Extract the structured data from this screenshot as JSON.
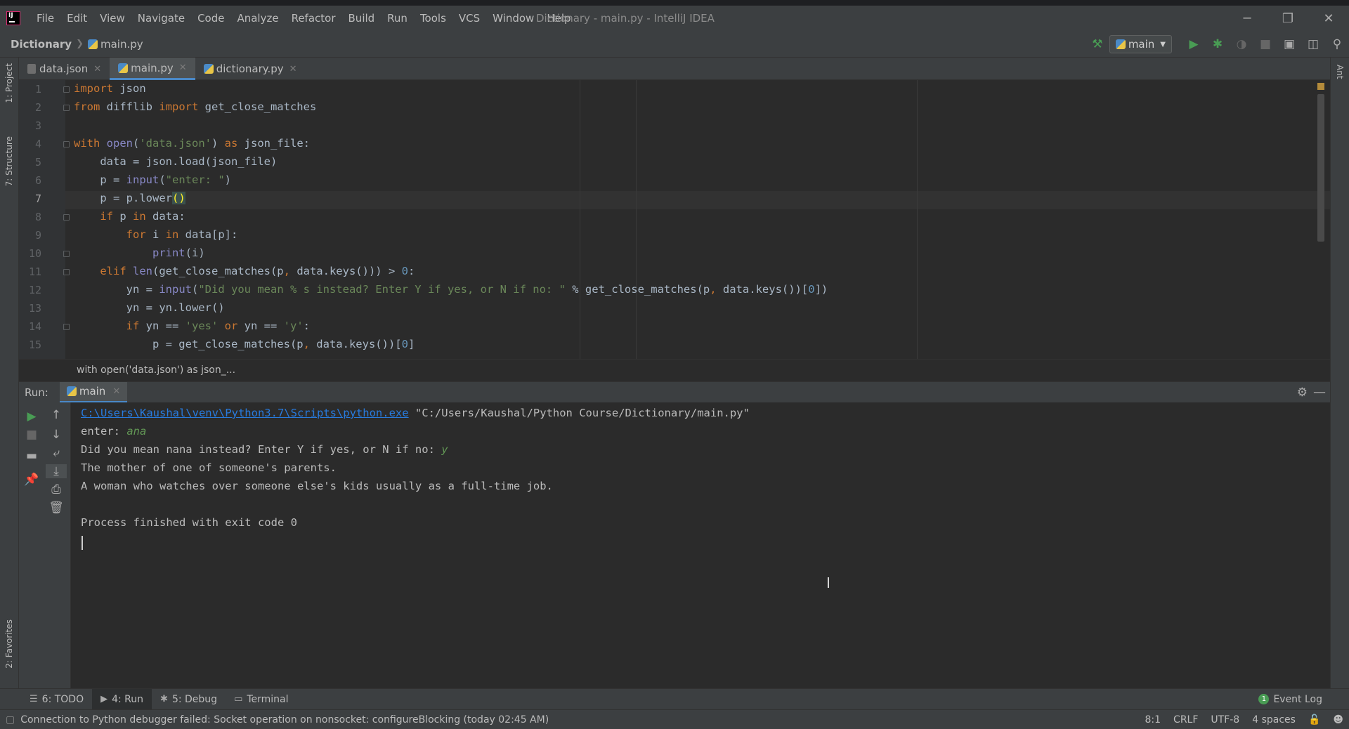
{
  "window": {
    "title": "Dictionary - main.py - IntelliJ IDEA",
    "minimize": "─",
    "restore": "❐",
    "close": "✕"
  },
  "menu": [
    "File",
    "Edit",
    "View",
    "Navigate",
    "Code",
    "Analyze",
    "Refactor",
    "Build",
    "Run",
    "Tools",
    "VCS",
    "Window",
    "Help"
  ],
  "nav": {
    "project": "Dictionary",
    "file": "main.py",
    "run_config": "main"
  },
  "left_strip": {
    "project": "1: Project",
    "structure": "7: Structure",
    "favorites": "2: Favorites"
  },
  "right_strip": {
    "ant": "Ant"
  },
  "tabs": [
    {
      "label": "data.json",
      "active": false
    },
    {
      "label": "main.py",
      "active": true
    },
    {
      "label": "dictionary.py",
      "active": false
    }
  ],
  "editor": {
    "line_numbers": [
      "1",
      "2",
      "3",
      "4",
      "5",
      "6",
      "7",
      "8",
      "9",
      "10",
      "11",
      "12",
      "13",
      "14",
      "15"
    ],
    "current_line": "7",
    "breadcrumb": "with open('data.json') as json_..."
  },
  "run": {
    "label": "Run:",
    "tab": "main",
    "console": {
      "exe_path": "C:\\Users\\Kaushal\\venv\\Python3.7\\Scripts\\python.exe",
      "script_path": " \"C:/Users/Kaushal/Python Course/Dictionary/main.py\"",
      "prompt1": "enter: ",
      "input1": "ana",
      "prompt2": "Did you mean nana instead? Enter Y if yes, or N if no: ",
      "input2": "y",
      "out1": "The mother of one of someone's parents.",
      "out2": "A woman who watches over someone else's kids usually as a full-time job.",
      "finish": "Process finished with exit code 0"
    }
  },
  "bottom_tools": [
    {
      "label": "6: TODO",
      "active": false
    },
    {
      "label": "4: Run",
      "active": true
    },
    {
      "label": "5: Debug",
      "active": false
    },
    {
      "label": "Terminal",
      "active": false
    }
  ],
  "event_log": {
    "count": "1",
    "label": "Event Log"
  },
  "status": {
    "message": "Connection to Python debugger failed: Socket operation on nonsocket: configureBlocking (today 02:45 AM)",
    "position": "8:1",
    "line_sep": "CRLF",
    "encoding": "UTF-8",
    "indent": "4 spaces"
  },
  "colors": {
    "keyword": "#cc7832",
    "string": "#6a8759",
    "number": "#6897bb",
    "link": "#287bde",
    "accent": "#4a88c7"
  }
}
